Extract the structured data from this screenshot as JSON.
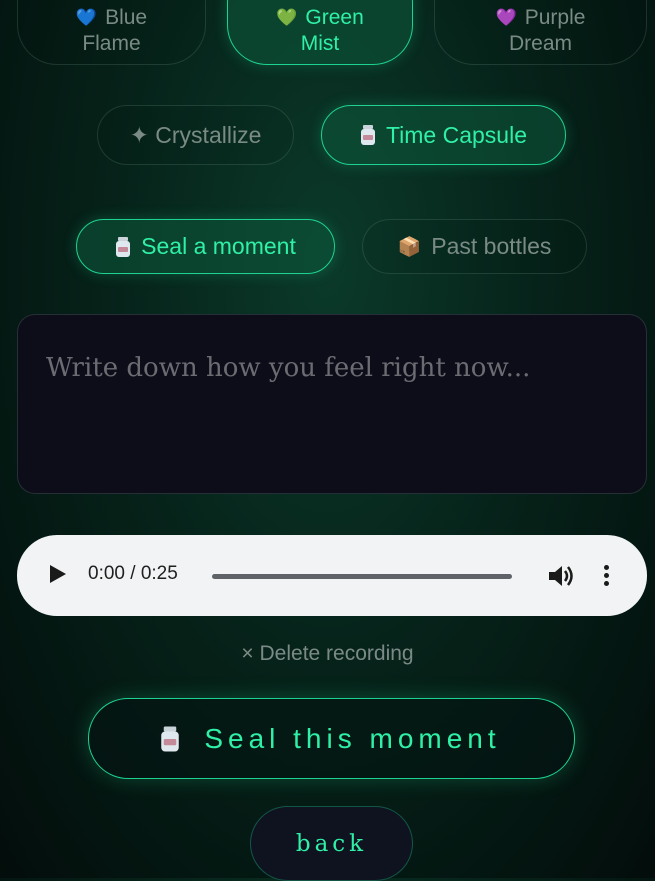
{
  "themes": [
    {
      "label_line1": "Blue",
      "label_line2": "Flame",
      "heart": "💙",
      "state": "inactive"
    },
    {
      "label_line1": "Green",
      "label_line2": "Mist",
      "heart": "💚",
      "state": "active"
    },
    {
      "label_line1": "Purple",
      "label_line2": "Dream",
      "heart": "💜",
      "state": "inactive"
    }
  ],
  "modes": [
    {
      "label": "✦ Crystallize",
      "state": "inactive"
    },
    {
      "label": "Time Capsule",
      "state": "active"
    }
  ],
  "tabs": [
    {
      "label": "Seal a moment",
      "state": "active"
    },
    {
      "label": "Past bottles",
      "icon": "📦",
      "state": "inactive"
    }
  ],
  "note": {
    "placeholder": "Write down how you feel right now..."
  },
  "audio": {
    "time": "0:00 / 0:25"
  },
  "delete_label": "× Delete recording",
  "seal_label": "Seal this moment",
  "back_label": "back",
  "colors": {
    "accent": "#2ff0a6",
    "accent_border": "#1ed391",
    "background": "#06231a"
  }
}
